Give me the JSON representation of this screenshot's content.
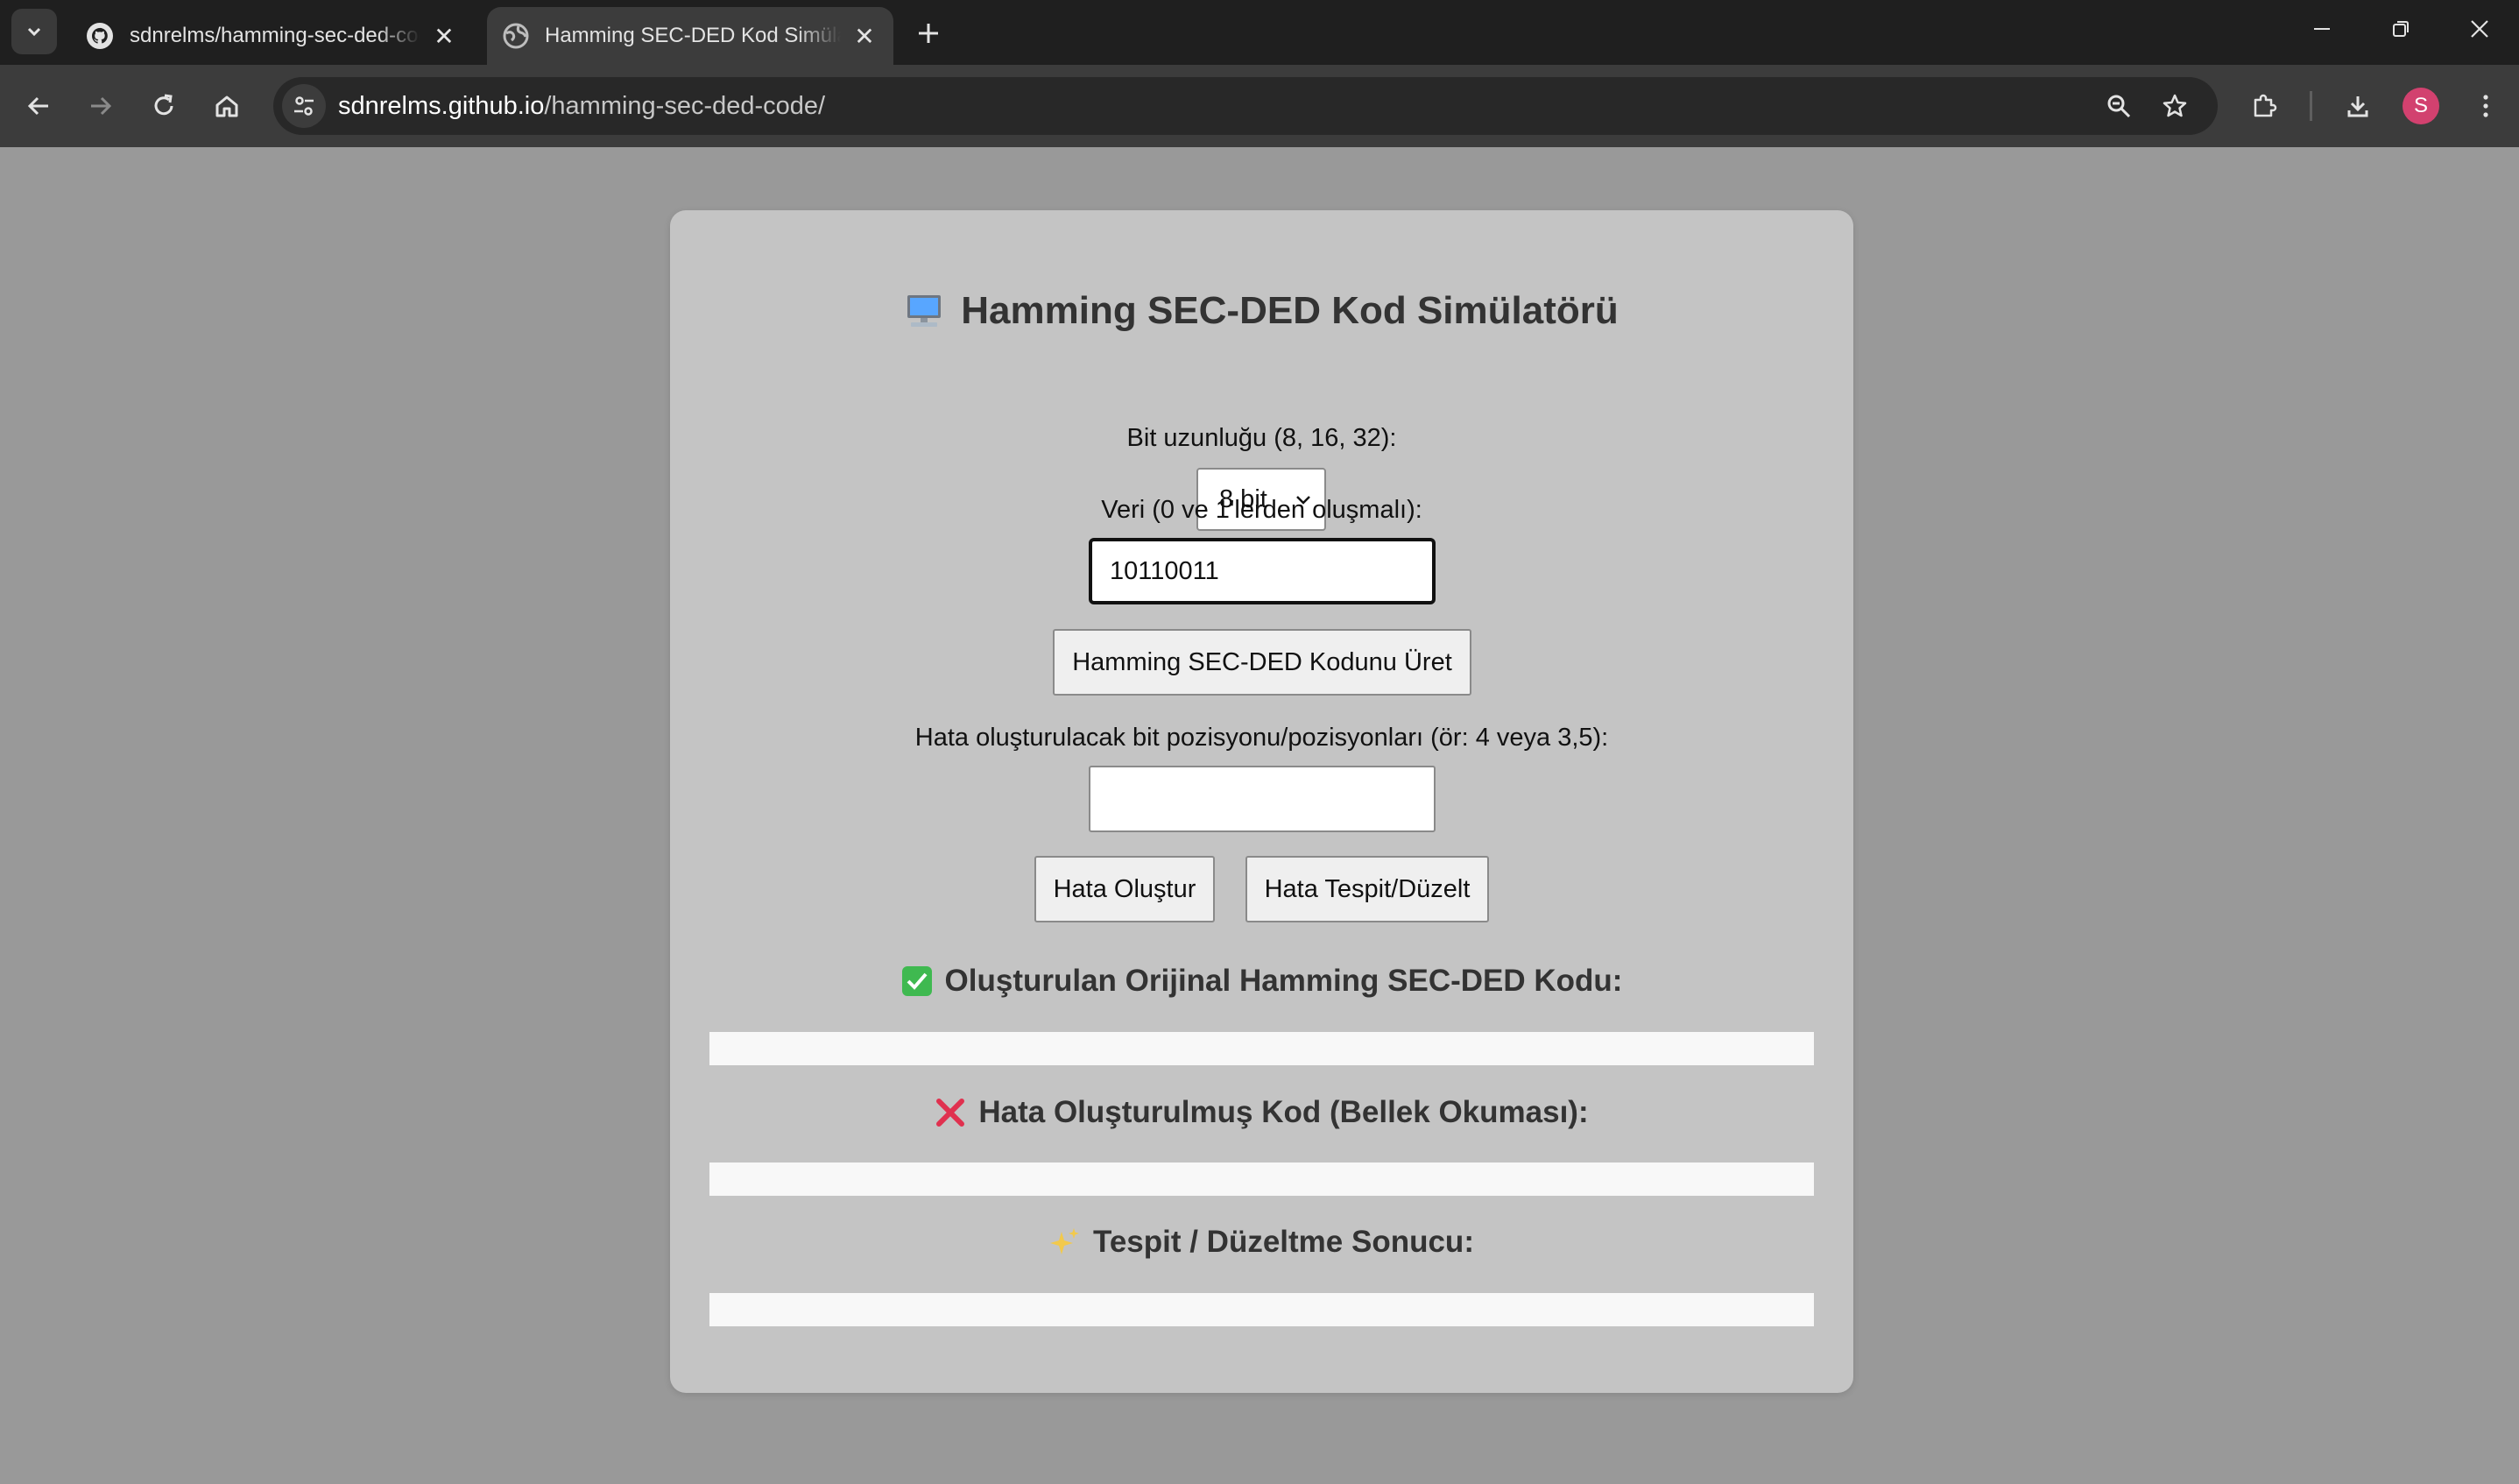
{
  "browser": {
    "tabs": [
      {
        "title": "sdnrelms/hamming-sec-ded-code",
        "active": false,
        "icon": "github-icon"
      },
      {
        "title": "Hamming SEC-DED Kod Simülatörü",
        "active": true,
        "icon": "globe-icon"
      }
    ],
    "url": {
      "host": "sdnrelms.github.io",
      "path": "/hamming-sec-ded-code/"
    },
    "profile_initial": "S"
  },
  "page": {
    "title": "Hamming SEC-DED Kod Simülatörü",
    "bit_length_label": "Bit uzunluğu (8, 16, 32):",
    "bit_length_value": "8 bit",
    "data_label": "Veri (0 ve 1'lerden oluşmalı):",
    "data_value": "10110011",
    "generate_button": "Hamming SEC-DED Kodunu Üret",
    "error_positions_label": "Hata oluşturulacak bit pozisyonu/pozisyonları (ör: 4 veya 3,5):",
    "error_positions_value": "",
    "create_error_button": "Hata Oluştur",
    "detect_correct_button": "Hata Tespit/Düzelt",
    "original_code_title": "Oluşturulan Orijinal Hamming SEC-DED Kodu:",
    "original_code_value": "",
    "corrupted_code_title": "Hata Oluşturulmuş Kod (Bellek Okuması):",
    "corrupted_code_value": "",
    "result_title": "Tespit / Düzeltme Sonucu:",
    "result_value": ""
  },
  "colors": {
    "page_bg": "#999999",
    "card_bg": "#c4c4c4",
    "check_green": "#3fb950",
    "cross_red": "#e0314f",
    "avatar": "#d2416f"
  }
}
